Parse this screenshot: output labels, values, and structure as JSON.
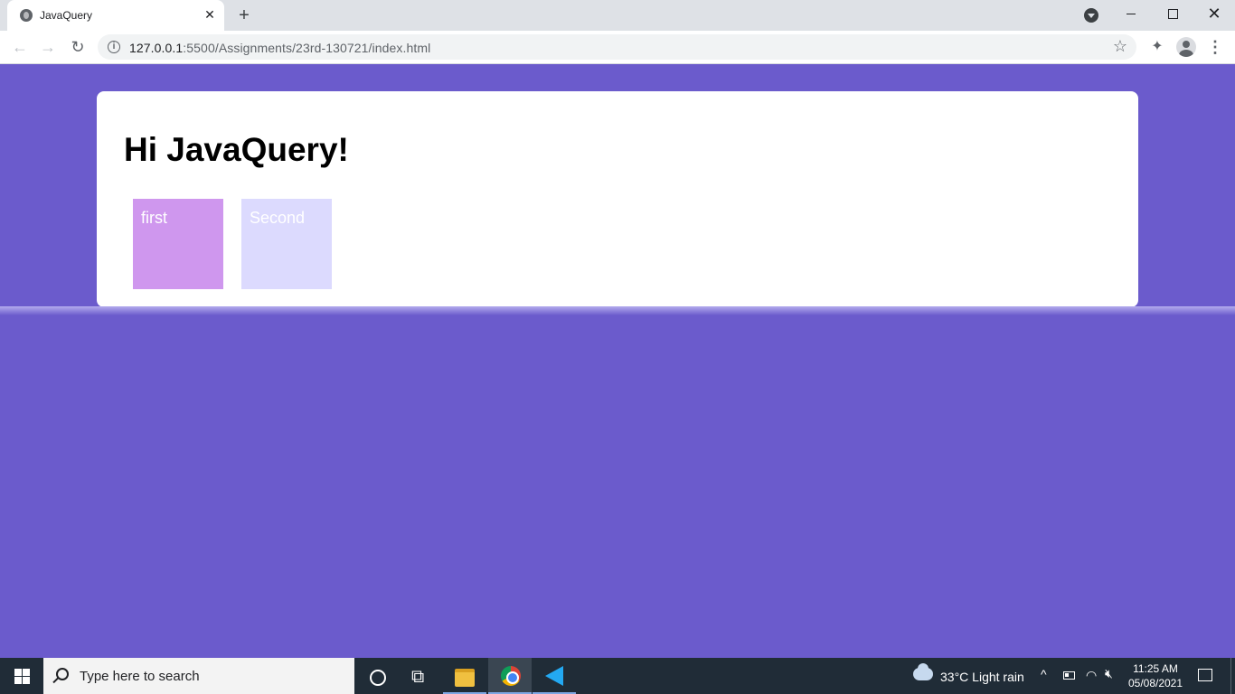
{
  "browser": {
    "tab_title": "JavaQuery",
    "tab_close": "✕",
    "new_tab": "+",
    "url_host": "127.0.0.1",
    "url_path": ":5500/Assignments/23rd-130721/index.html",
    "back": "←",
    "forward": "→",
    "reload": "↻",
    "star": "☆",
    "extensions": "✦",
    "menu": "⋮",
    "info": "i",
    "window_close": "✕"
  },
  "page": {
    "heading": "Hi JavaQuery!",
    "boxes": [
      {
        "label": "first"
      },
      {
        "label": "Second"
      }
    ]
  },
  "taskbar": {
    "search_placeholder": "Type here to search",
    "weather": "33°C  Light rain",
    "tray_up": "^",
    "wifi": "◠",
    "volume": "🔇︎",
    "time": "11:25 AM",
    "date": "05/08/2021"
  },
  "colors": {
    "page_bg": "#6b5bcc",
    "card_bg": "#ffffff",
    "box_first": "#cf97ee",
    "box_second": "#dcdafe"
  }
}
